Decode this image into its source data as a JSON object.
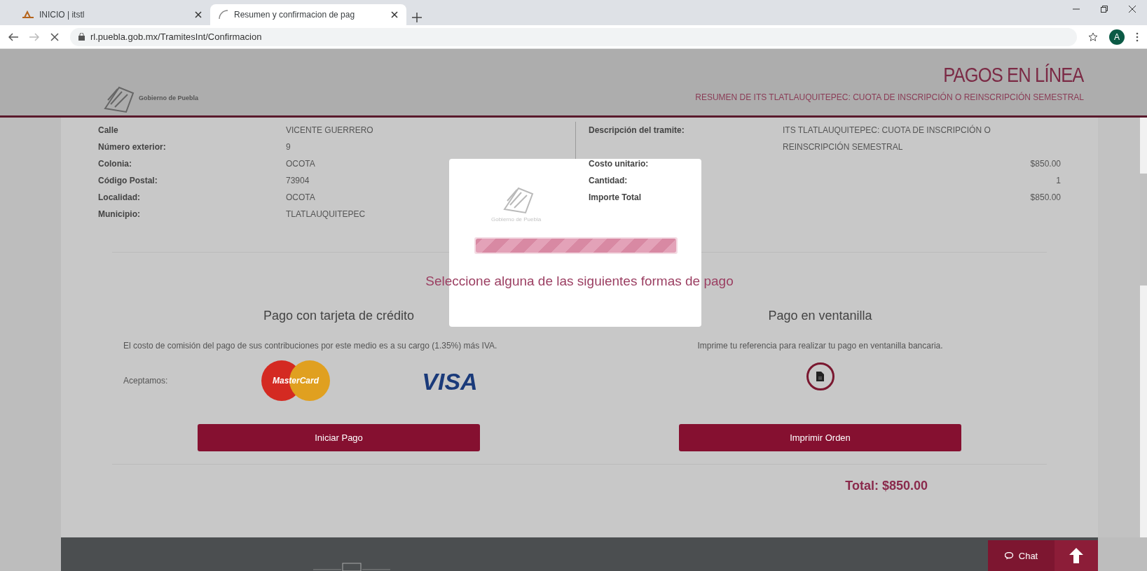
{
  "browser": {
    "tabs": [
      {
        "title": "INICIO | itstl",
        "selected": false
      },
      {
        "title": "Resumen y confirmacion de pag",
        "selected": true
      }
    ],
    "url": "rl.puebla.gob.mx/TramitesInt/Confirmacion",
    "profile": "A"
  },
  "header": {
    "logo_text": "Gobierno de Puebla",
    "title": "PAGOS EN LÍNEA",
    "subtitle": "RESUMEN DE ITS TLATLAUQUITEPEC: CUOTA DE INSCRIPCIÓN O REINSCRIPCIÓN SEMESTRAL"
  },
  "address": [
    {
      "label": "Calle",
      "value": "VICENTE GUERRERO"
    },
    {
      "label": "Número exterior:",
      "value": "9"
    },
    {
      "label": "Colonia:",
      "value": "OCOTA"
    },
    {
      "label": "Código Postal:",
      "value": "73904"
    },
    {
      "label": "Localidad:",
      "value": "OCOTA"
    },
    {
      "label": "Municipio:",
      "value": "TLATLAUQUITEPEC"
    }
  ],
  "summary": [
    {
      "kind": "text",
      "label": "Descripción del tramite:",
      "value": "ITS TLATLAUQUITEPEC: CUOTA DE INSCRIPCIÓN O REINSCRIPCIÓN SEMESTRAL"
    },
    {
      "kind": "amount",
      "label": "Costo unitario:",
      "value": "$850.00"
    },
    {
      "kind": "amount",
      "label": "Cantidad:",
      "value": "1"
    },
    {
      "kind": "amount",
      "label": "Importe Total",
      "value": "$850.00"
    }
  ],
  "loading": {
    "logo_text": "Gobierno de Puebla",
    "level": 1
  },
  "payment": {
    "heading": "Seleccione alguna de las siguientes formas de pago",
    "card": {
      "title": "Pago con tarjeta de crédito",
      "text": "El costo de comisión del pago de sus contribuciones por este medio es a su cargo (1.35%) más IVA.",
      "accept_label": "Aceptamos:",
      "brands": [
        "MasterCard",
        "VISA"
      ],
      "button": "Iniciar Pago"
    },
    "counter": {
      "title": "Pago en ventanilla",
      "text": "Imprime tu referencia para realizar tu pago en ventanilla bancaria.",
      "button": "Imprimir Orden"
    }
  },
  "total": "Total: $850.00",
  "chat": "Chat"
}
